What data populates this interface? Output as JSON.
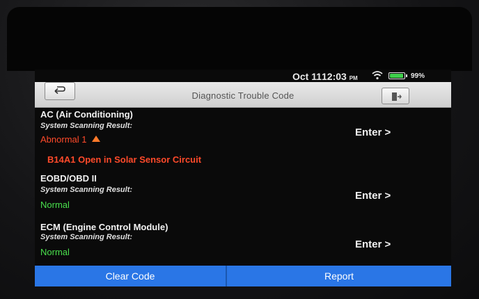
{
  "status_bar": {
    "date": "Oct 11",
    "time": "12:03",
    "ampm": "PM",
    "battery": "99%"
  },
  "header": {
    "title": "Diagnostic Trouble Code"
  },
  "systems": [
    {
      "name": "AC (Air Conditioning)",
      "result_label": "System Scanning Result:",
      "status": "Abnormal 1",
      "dtc": "B14A1 Open in Solar Sensor Circuit",
      "enter_label": "Enter >"
    },
    {
      "name": "EOBD/OBD II",
      "result_label": "System Scanning Result:",
      "status": "Normal",
      "enter_label": "Enter >"
    },
    {
      "name": "ECM (Engine Control Module)",
      "result_label": "System Scanning Result:",
      "status": "Normal",
      "enter_label": "Enter >"
    }
  ],
  "footer": {
    "clear_label": "Clear Code",
    "report_label": "Report"
  },
  "colors": {
    "abnormal": "#ff4a2a",
    "normal": "#49e04c",
    "accent": "#2a76e6"
  }
}
